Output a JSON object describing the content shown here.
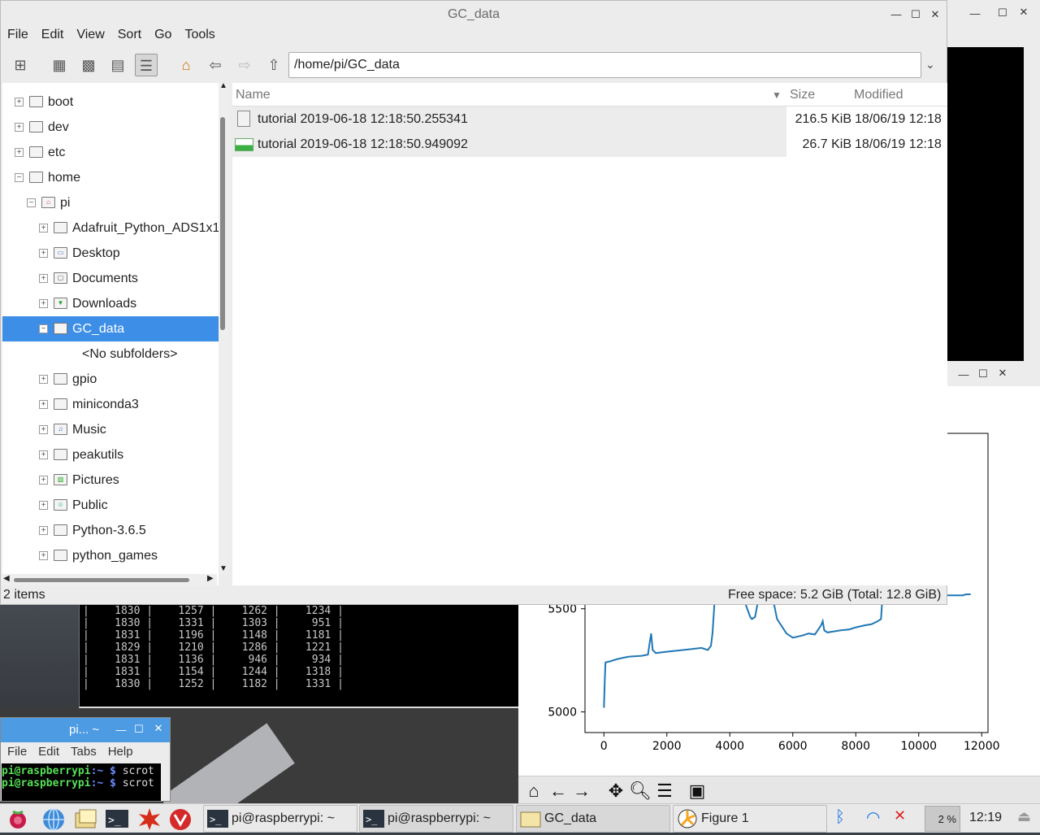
{
  "file_manager": {
    "title": "GC_data",
    "menu": [
      "File",
      "Edit",
      "View",
      "Sort",
      "Go",
      "Tools"
    ],
    "path": "/home/pi/GC_data",
    "tree": [
      {
        "label": "boot",
        "expander": "+"
      },
      {
        "label": "dev",
        "expander": "+"
      },
      {
        "label": "etc",
        "expander": "+"
      },
      {
        "label": "home",
        "expander": "−"
      },
      {
        "label": "pi",
        "expander": "−"
      },
      {
        "label": "Adafruit_Python_ADS1x15",
        "expander": "+"
      },
      {
        "label": "Desktop",
        "expander": "+"
      },
      {
        "label": "Documents",
        "expander": "+"
      },
      {
        "label": "Downloads",
        "expander": "+"
      },
      {
        "label": "GC_data",
        "expander": "−"
      },
      {
        "label": "<No subfolders>",
        "expander": ""
      },
      {
        "label": "gpio",
        "expander": "+"
      },
      {
        "label": "miniconda3",
        "expander": "+"
      },
      {
        "label": "Music",
        "expander": "+"
      },
      {
        "label": "peakutils",
        "expander": "+"
      },
      {
        "label": "Pictures",
        "expander": "+"
      },
      {
        "label": "Public",
        "expander": "+"
      },
      {
        "label": "Python-3.6.5",
        "expander": "+"
      },
      {
        "label": "python_games",
        "expander": "+"
      }
    ],
    "columns": {
      "name": "Name",
      "size": "Size",
      "modified": "Modified"
    },
    "files": [
      {
        "name": "tutorial 2019-06-18 12:18:50.255341",
        "size": "216.5 KiB",
        "modified": "18/06/19 12:18",
        "icon": "text-file-icon"
      },
      {
        "name": "tutorial 2019-06-18 12:18:50.949092",
        "size": "26.7 KiB",
        "modified": "18/06/19 12:18",
        "icon": "image-file-icon"
      }
    ],
    "status_items": "2 items",
    "status_space": "Free space: 5.2 GiB (Total: 12.8 GiB)"
  },
  "terminal_output": [
    "|    1830 |    1257 |    1262 |    1234 |",
    "|    1830 |    1331 |    1303 |     951 |",
    "|    1831 |    1196 |    1148 |    1181 |",
    "|    1829 |    1210 |    1286 |    1221 |",
    "|    1831 |    1136 |     946 |     934 |",
    "|    1831 |    1154 |    1244 |    1318 |",
    "|    1830 |    1252 |    1182 |    1331 |"
  ],
  "small_terminal": {
    "title": "pi... ~",
    "menu": [
      "File",
      "Edit",
      "Tabs",
      "Help"
    ],
    "lines": [
      {
        "user": "pi@raspberrypi",
        "path": ":~ $",
        "cmd": " scrot"
      },
      {
        "user": "pi@raspberrypi",
        "path": ":~ $",
        "cmd": " scrot"
      }
    ]
  },
  "chart_data": {
    "type": "line",
    "title": "",
    "xlabel": "",
    "ylabel": "",
    "xlim": [
      -600,
      12200
    ],
    "ylim": [
      4900,
      6350
    ],
    "xticks": [
      "0",
      "2000",
      "4000",
      "6000",
      "8000",
      "10000",
      "12000"
    ],
    "yticks": [
      "5000",
      "5500"
    ],
    "color": "#1f77b4",
    "series": [
      {
        "x": [
          0,
          30,
          50,
          200,
          400,
          600,
          800,
          1000,
          1200,
          1400,
          1450,
          1500,
          1550,
          1650,
          1900,
          2200,
          2500,
          2800,
          3100,
          3300,
          3400,
          3450,
          3500,
          3600,
          3700,
          3800,
          3900,
          4050,
          4200,
          4300,
          4400,
          4550,
          4650,
          4700,
          4800,
          4900,
          4950,
          5000,
          5100,
          5200,
          5300,
          5500,
          5800,
          6000,
          6300,
          6500,
          6700,
          6900,
          6950,
          7000,
          7100,
          7300,
          7500,
          7800,
          8000,
          8300,
          8500,
          8700,
          8800,
          8850,
          8900,
          9000,
          9100,
          9200,
          9250,
          9300,
          9400,
          9500,
          9600,
          9700,
          9800,
          10000,
          10200,
          10400,
          10600,
          10800,
          11000,
          11200,
          11400,
          11500,
          11650
        ],
        "y": [
          5020,
          5160,
          5240,
          5245,
          5255,
          5262,
          5268,
          5270,
          5272,
          5278,
          5330,
          5380,
          5300,
          5285,
          5290,
          5295,
          5300,
          5305,
          5310,
          5300,
          5320,
          5380,
          5500,
          5800,
          6100,
          6350,
          6350,
          6200,
          5900,
          5650,
          5570,
          5500,
          5460,
          5450,
          5460,
          5540,
          5650,
          5740,
          5800,
          5720,
          5600,
          5450,
          5380,
          5360,
          5370,
          5380,
          5375,
          5420,
          5440,
          5395,
          5385,
          5390,
          5395,
          5400,
          5410,
          5420,
          5425,
          5440,
          5450,
          5560,
          5900,
          6300,
          6350,
          6350,
          6300,
          5950,
          5750,
          5620,
          5580,
          5570,
          5560,
          5565,
          5570,
          5560,
          5565,
          5565,
          5565,
          5565,
          5565,
          5570,
          5570
        ]
      }
    ]
  },
  "taskbar": {
    "buttons": [
      {
        "label": "pi@raspberrypi: ~"
      },
      {
        "label": "pi@raspberrypi: ~"
      },
      {
        "label": "GC_data"
      },
      {
        "label": "Figure 1"
      }
    ],
    "cpu": "2 %",
    "clock": "12:19"
  }
}
